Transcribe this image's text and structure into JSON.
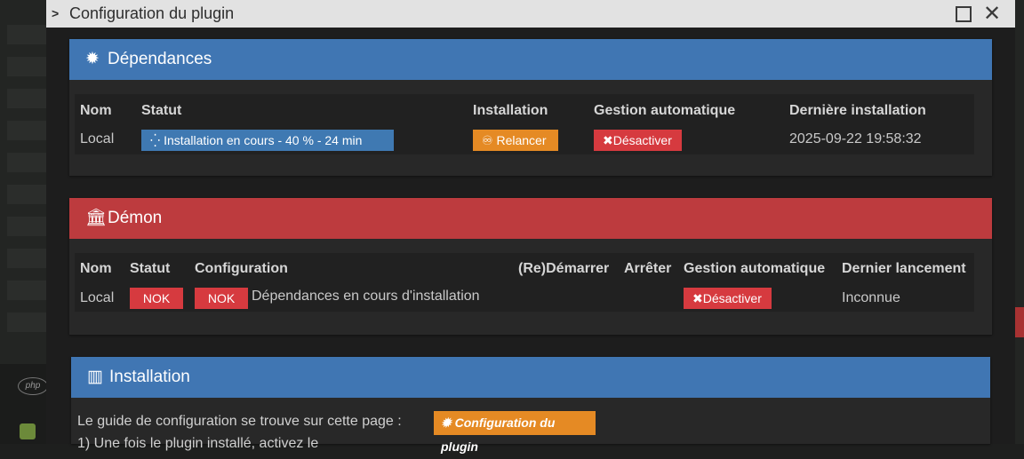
{
  "dialog": {
    "title": "Configuration du plugin",
    "chevron": "›",
    "close": "✕"
  },
  "dependencies": {
    "title": "Dépendances",
    "icon": "gear-icon",
    "headers": [
      "Nom",
      "Statut",
      "Installation",
      "Gestion automatique",
      "Dernière installation"
    ],
    "row": {
      "name": "Local",
      "status": "Installation en cours - 40 % - 24 min",
      "install_btn": "Relancer",
      "auto_btn": "Désactiver",
      "last_install": "2025-09-22 19:58:32"
    }
  },
  "daemon": {
    "title": "Démon",
    "icon": "bank-icon",
    "headers": [
      "Nom",
      "Statut",
      "Configuration",
      "(Re)Démarrer",
      "Arrêter",
      "Gestion automatique",
      "Dernier lancement"
    ],
    "row": {
      "name": "Local",
      "status": "NOK",
      "config_status": "NOK",
      "config_text": "Dépendances en cours d'installation",
      "auto_btn": "Désactiver",
      "last_launch": "Inconnue"
    }
  },
  "installation": {
    "title": "Installation",
    "icon": "map-icon",
    "guide_text": "Le guide de configuration se trouve sur cette page :",
    "guide_btn": "Configuration du plugin",
    "step1": "1) Une fois le plugin installé, activez le"
  },
  "colors": {
    "accent_blue": "#4076b3",
    "danger_red": "#bd3b3e",
    "warning_orange": "#e58a24"
  }
}
